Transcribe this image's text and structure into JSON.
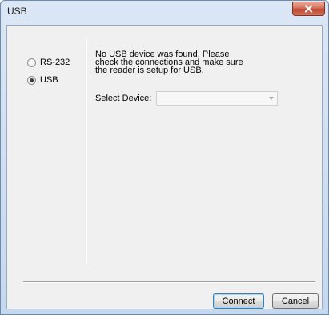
{
  "window": {
    "title": "USB",
    "close_icon": "close-icon"
  },
  "connection_type": {
    "options": [
      {
        "label": "RS-232",
        "checked": false
      },
      {
        "label": "USB",
        "checked": true
      }
    ]
  },
  "main": {
    "message": "No USB device was found. Please check the connections and make sure the reader is setup for USB.",
    "select_label": "Select Device:",
    "select_value": ""
  },
  "footer": {
    "connect_label": "Connect",
    "cancel_label": "Cancel"
  },
  "colors": {
    "window_frame": "#c6d8ee",
    "client_background": "#f0f0f0",
    "close_button": "#c0482f"
  }
}
